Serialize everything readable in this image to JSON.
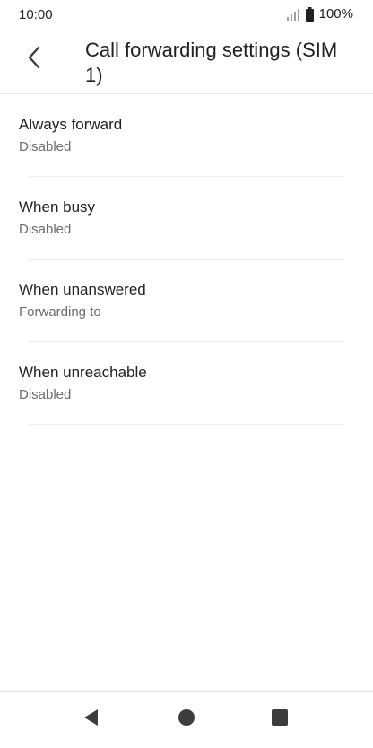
{
  "status_bar": {
    "time": "10:00",
    "battery": "100%",
    "icons": [
      "signal-icon",
      "battery-icon"
    ]
  },
  "app_bar": {
    "title": "Call forwarding settings (SIM 1)",
    "back_icon": "chevron-left-icon"
  },
  "items": [
    {
      "title": "Always forward",
      "summary": "Disabled"
    },
    {
      "title": "When busy",
      "summary": "Disabled"
    },
    {
      "title": "When unanswered",
      "summary": "Forwarding to"
    },
    {
      "title": "When unreachable",
      "summary": "Disabled"
    }
  ],
  "nav_bar": {
    "icons": [
      "nav-back-icon",
      "nav-home-icon",
      "nav-recents-icon"
    ]
  },
  "colors": {
    "primary_text": "#202124",
    "secondary_text": "#6b6b6b",
    "icon": "#3c3c3c",
    "divider": "#ececec"
  }
}
